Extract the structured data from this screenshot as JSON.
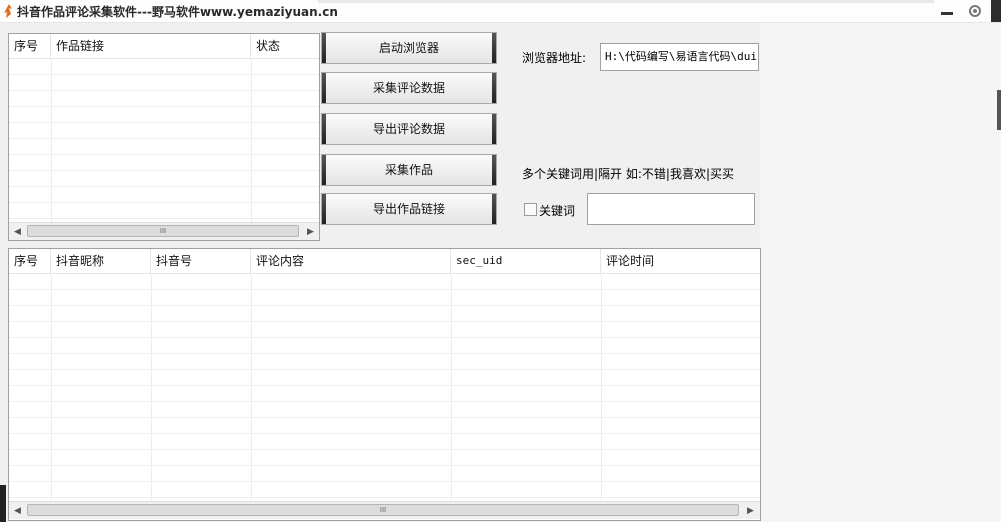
{
  "window": {
    "title": "抖音作品评论采集软件---野马软件www.yemaziyuan.cn",
    "min_icon": "minimize-icon",
    "settings_icon": "gear-icon"
  },
  "works_table": {
    "columns": [
      "序号",
      "作品链接",
      "状态"
    ],
    "rows": []
  },
  "buttons": {
    "launch_browser": "启动浏览器",
    "collect_comments": "采集评论数据",
    "export_comments": "导出评论数据",
    "collect_works": "采集作品",
    "export_work_links": "导出作品链接"
  },
  "browser": {
    "label": "浏览器地址:",
    "path_value": "H:\\代码编写\\易语言代码\\dui"
  },
  "keyword": {
    "hint": "多个关键词用|隔开 如:不错|我喜欢|买买",
    "checkbox_label": "关键词",
    "checked": false,
    "value": ""
  },
  "comments_table": {
    "columns": [
      "序号",
      "抖音昵称",
      "抖音号",
      "评论内容",
      "sec_uid",
      "评论时间"
    ],
    "rows": []
  },
  "scrollbar": {
    "thumb_glyph": "III"
  }
}
